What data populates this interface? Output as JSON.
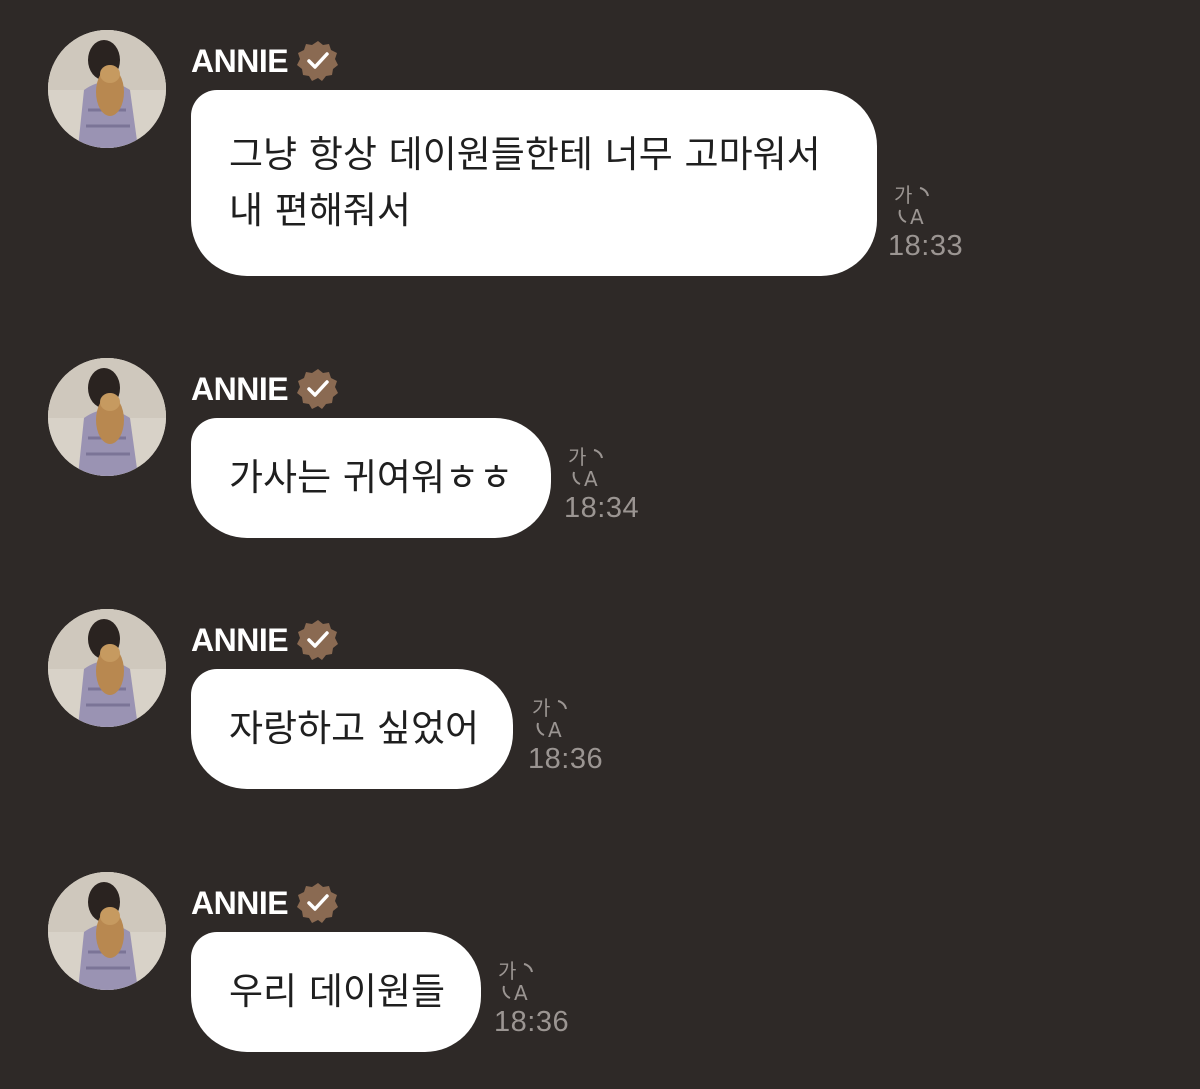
{
  "messages": [
    {
      "sender": "ANNIE",
      "text": "그냥 항상 데이원들한테 너무 고마워서\n내 편해줘서",
      "time": "18:33"
    },
    {
      "sender": "ANNIE",
      "text": "가사는 귀여워ㅎㅎ",
      "time": "18:34"
    },
    {
      "sender": "ANNIE",
      "text": "자랑하고 싶었어",
      "time": "18:36"
    },
    {
      "sender": "ANNIE",
      "text": "우리 데이원들",
      "time": "18:36"
    }
  ],
  "colors": {
    "background": "#2e2927",
    "bubble": "#ffffff",
    "verified_badge": "#8a6a52",
    "meta_text": "#9b9592"
  },
  "icons": {
    "verified": "verified-badge-icon",
    "translate": "translate-icon"
  }
}
